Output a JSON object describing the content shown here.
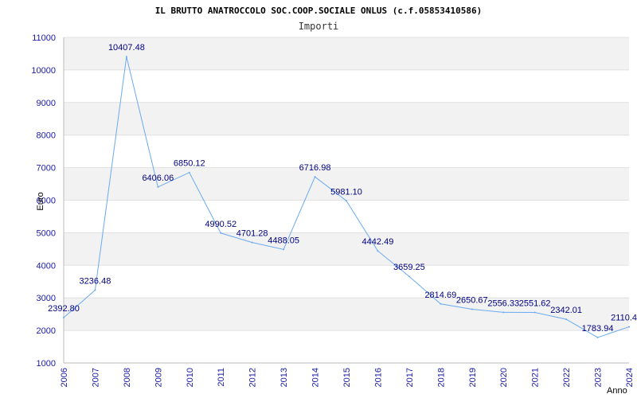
{
  "chart_data": {
    "type": "line",
    "title": "IL BRUTTO ANATROCCOLO SOC.COOP.SOCIALE ONLUS (c.f.05853410586)",
    "subtitle": "Importi",
    "xlabel": "Anno",
    "ylabel": "Euro",
    "ylim": [
      1000,
      11000
    ],
    "yticks": [
      "1000",
      "2000",
      "3000",
      "4000",
      "5000",
      "6000",
      "7000",
      "8000",
      "9000",
      "10000",
      "11000"
    ],
    "categories": [
      "2006",
      "2007",
      "2008",
      "2009",
      "2010",
      "2011",
      "2012",
      "2013",
      "2014",
      "2015",
      "2016",
      "2017",
      "2018",
      "2019",
      "2020",
      "2021",
      "2022",
      "2023",
      "2024"
    ],
    "values": [
      2392.8,
      3236.48,
      10407.48,
      6406.06,
      6850.12,
      4990.52,
      4701.28,
      4488.05,
      6716.98,
      5981.1,
      4442.49,
      3659.25,
      2814.69,
      2650.67,
      2556.33,
      2551.62,
      2342.01,
      1783.94,
      2110.4
    ],
    "data_labels": [
      "2392.80",
      "3236.48",
      "10407.48",
      "6406.06",
      "6850.12",
      "4990.52",
      "4701.28",
      "4488.05",
      "6716.98",
      "5981.10",
      "4442.49",
      "3659.25",
      "2814.69",
      "2650.67",
      "2556.33",
      "2551.62",
      "2342.01",
      "1783.94",
      "2110.4"
    ],
    "grid": "horizontal bands",
    "colors": {
      "line": "#6aaaf0",
      "band": "#f2f2f2",
      "gridline": "#e0e0e0",
      "tick_text": "#1a1aa6",
      "label_text": "#000080"
    }
  }
}
